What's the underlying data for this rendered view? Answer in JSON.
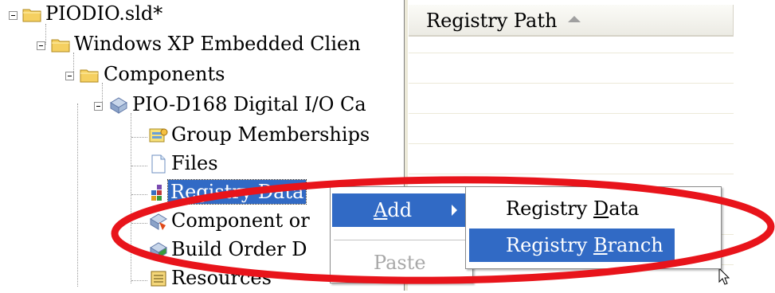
{
  "tree": {
    "root": "PIODIO.sld*",
    "client": "Windows XP Embedded Clien",
    "components": "Components",
    "component": "PIO-D168 Digital I/O Ca",
    "group": "Group Memberships",
    "files": "Files",
    "registry": "Registry Data",
    "component_or": "Component or",
    "build_order": "Build Order D",
    "resources": "Resources"
  },
  "list": {
    "column_header": "Registry Path"
  },
  "context_menu": {
    "add": "Add",
    "add_underline": "A",
    "add_rest": "dd",
    "paste": "Paste"
  },
  "submenu": {
    "registry_data_prefix": "Registry ",
    "registry_data_ul": "D",
    "registry_data_rest": "ata",
    "registry_branch_prefix": "Registry ",
    "registry_branch_ul": "B",
    "registry_branch_rest": "ranch"
  },
  "colors": {
    "highlight": "#316ac5",
    "annotation": "#e8141b",
    "folder": "#f5d061"
  },
  "icons": [
    "minus-box-icon",
    "folder-icon",
    "component-icon",
    "group-memberships-icon",
    "file-icon",
    "registry-icon",
    "component-dependency-icon",
    "build-order-icon",
    "resources-icon",
    "arrow-cursor-icon"
  ]
}
